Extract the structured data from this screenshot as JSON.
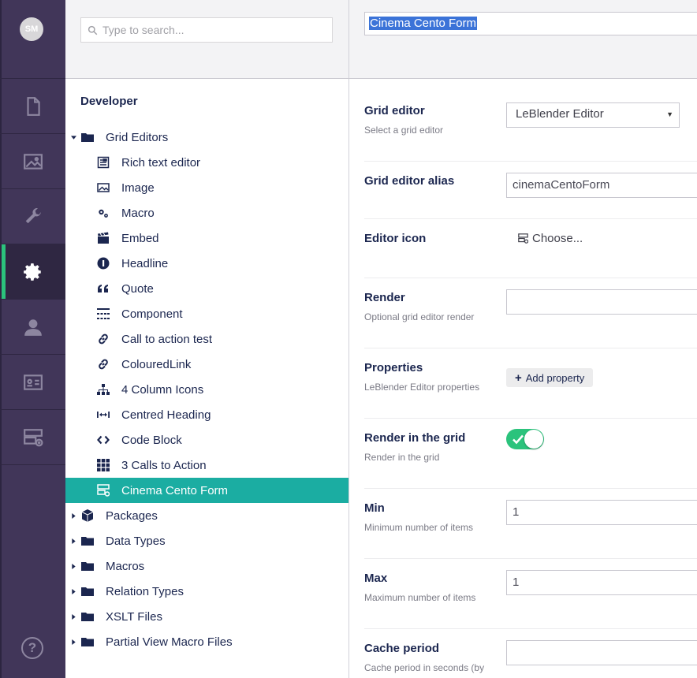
{
  "user": {
    "initials": "SM"
  },
  "sections": [
    {
      "name": "content",
      "icon": "document-icon"
    },
    {
      "name": "media",
      "icon": "image-icon"
    },
    {
      "name": "settings",
      "icon": "wrench-icon"
    },
    {
      "name": "developer",
      "icon": "gear-icon",
      "active": true
    },
    {
      "name": "users",
      "icon": "user-icon"
    },
    {
      "name": "members",
      "icon": "id-card-icon"
    },
    {
      "name": "forms",
      "icon": "form-icon"
    }
  ],
  "help": {
    "glyph": "?"
  },
  "search": {
    "placeholder": "Type to search..."
  },
  "tree": {
    "root": "Developer",
    "grid_editors": {
      "label": "Grid Editors",
      "items": [
        {
          "label": "Rich text editor",
          "icon": "rte-icon"
        },
        {
          "label": "Image",
          "icon": "image-icon"
        },
        {
          "label": "Macro",
          "icon": "cogs-icon"
        },
        {
          "label": "Embed",
          "icon": "clapper-icon"
        },
        {
          "label": "Headline",
          "icon": "info-circle-icon"
        },
        {
          "label": "Quote",
          "icon": "quote-icon"
        },
        {
          "label": "Component",
          "icon": "component-icon"
        },
        {
          "label": "Call to action test",
          "icon": "link-icon"
        },
        {
          "label": "ColouredLink",
          "icon": "link-icon"
        },
        {
          "label": "4 Column Icons",
          "icon": "sitemap-icon"
        },
        {
          "label": "Centred Heading",
          "icon": "width-icon"
        },
        {
          "label": "Code Block",
          "icon": "code-icon"
        },
        {
          "label": "3 Calls to Action",
          "icon": "grid-icon"
        },
        {
          "label": "Cinema Cento Form",
          "icon": "form-icon",
          "selected": true
        }
      ]
    },
    "folders": [
      {
        "label": "Packages",
        "icon": "package-icon"
      },
      {
        "label": "Data Types",
        "icon": "folder-icon"
      },
      {
        "label": "Macros",
        "icon": "folder-icon"
      },
      {
        "label": "Relation Types",
        "icon": "folder-icon"
      },
      {
        "label": "XSLT Files",
        "icon": "folder-icon"
      },
      {
        "label": "Partial View Macro Files",
        "icon": "folder-icon"
      }
    ]
  },
  "editor": {
    "name": "Cinema Cento Form",
    "grid_editor": {
      "label": "Grid editor",
      "desc": "Select a grid editor",
      "value": "LeBlender Editor"
    },
    "alias": {
      "label": "Grid editor alias",
      "value": "cinemaCentoForm"
    },
    "icon": {
      "label": "Editor icon",
      "choose": "Choose..."
    },
    "render": {
      "label": "Render",
      "desc": "Optional grid editor render",
      "value": ""
    },
    "properties": {
      "label": "Properties",
      "desc": "LeBlender Editor properties",
      "button": "Add property"
    },
    "render_in_grid": {
      "label": "Render in the grid",
      "desc": "Render in the grid",
      "on": true
    },
    "min": {
      "label": "Min",
      "desc": "Minimum number of items",
      "value": "1"
    },
    "max": {
      "label": "Max",
      "desc": "Maximum number of items",
      "value": "1"
    },
    "cache": {
      "label": "Cache period",
      "desc": "Cache period in seconds (by"
    }
  },
  "colors": {
    "rail": "#413659",
    "accent": "#2bc37c",
    "selected": "#1bada2",
    "text": "#1b264f"
  }
}
